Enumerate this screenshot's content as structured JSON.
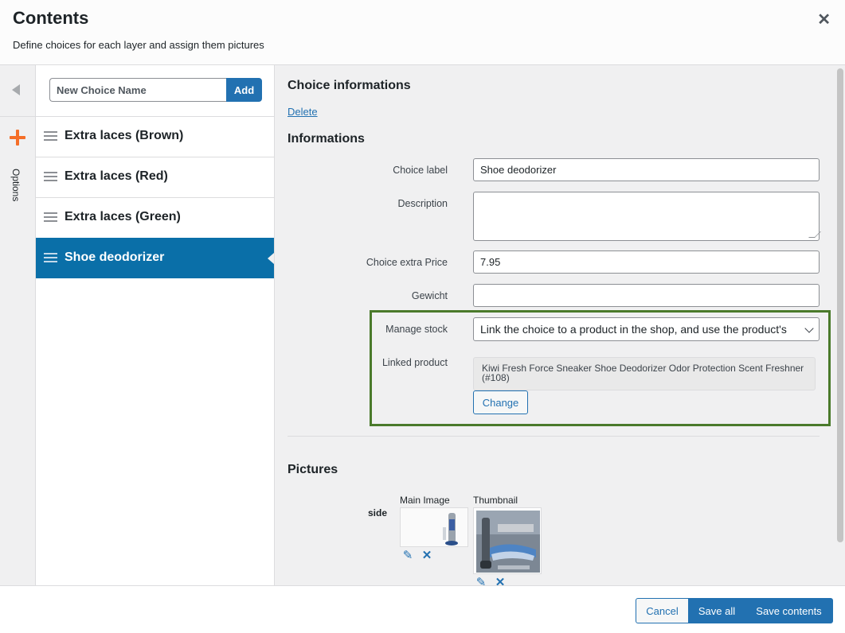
{
  "header": {
    "title": "Contents",
    "subtitle": "Define choices for each layer and assign them pictures",
    "close_icon": "close-icon"
  },
  "rail": {
    "toggle_icon": "collapse-left-icon",
    "add_icon": "plus-icon",
    "options_label": "Options"
  },
  "choices": {
    "new_placeholder": "New Choice Name",
    "add_label": "Add",
    "items": [
      {
        "label": "Extra laces (Brown)",
        "active": false
      },
      {
        "label": "Extra laces (Red)",
        "active": false
      },
      {
        "label": "Extra laces (Green)",
        "active": false
      },
      {
        "label": "Shoe deodorizer",
        "active": true
      }
    ]
  },
  "details": {
    "section_title": "Choice informations",
    "delete_label": "Delete",
    "informations_title": "Informations",
    "fields": {
      "choice_label": {
        "label": "Choice label",
        "value": "Shoe deodorizer"
      },
      "description": {
        "label": "Description",
        "value": ""
      },
      "extra_price": {
        "label": "Choice extra Price",
        "value": "7.95"
      },
      "weight": {
        "label": "Gewicht",
        "value": ""
      },
      "manage_stock": {
        "label": "Manage stock",
        "value": "Link the choice to a product in the shop, and use the product's"
      },
      "linked_product": {
        "label": "Linked product",
        "value": "Kiwi Fresh Force Sneaker Shoe Deodorizer Odor Protection Scent Freshner (#108)",
        "change_label": "Change"
      }
    },
    "accent_color": "#4a7a2b"
  },
  "pictures": {
    "title": "Pictures",
    "layer_label": "side",
    "main_image_label": "Main Image",
    "thumbnail_label": "Thumbnail",
    "edit_icon": "pencil-icon",
    "remove_icon": "x-icon"
  },
  "footer": {
    "cancel_label": "Cancel",
    "save_all_label": "Save all",
    "save_contents_label": "Save contents"
  },
  "colors": {
    "primary": "#2271b1",
    "active_item": "#0a6fa8",
    "add_accent": "#f56e28"
  }
}
